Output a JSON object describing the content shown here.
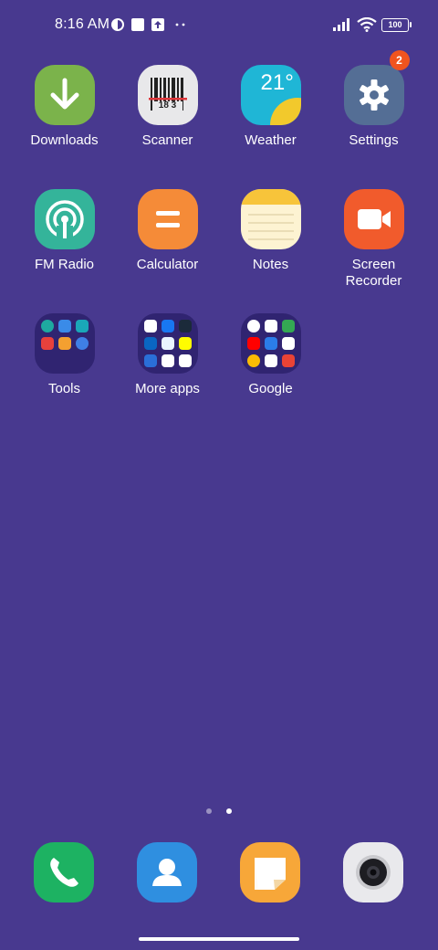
{
  "status_bar": {
    "time": "8:16 AM",
    "battery": "100"
  },
  "apps": [
    {
      "label": "Downloads",
      "icon": "downloads-icon"
    },
    {
      "label": "Scanner",
      "icon": "barcode-scanner-icon",
      "icon_text": "18 3"
    },
    {
      "label": "Weather",
      "icon": "weather-icon",
      "icon_text": "21°"
    },
    {
      "label": "Settings",
      "icon": "gear-icon",
      "badge": "2"
    },
    {
      "label": "FM Radio",
      "icon": "radio-icon"
    },
    {
      "label": "Calculator",
      "icon": "calculator-icon"
    },
    {
      "label": "Notes",
      "icon": "notes-icon"
    },
    {
      "label": "Screen Recorder",
      "label_line1": "Screen",
      "label_line2": "Recorder",
      "icon": "video-camera-icon"
    },
    {
      "label": "Tools",
      "icon": "folder-icon"
    },
    {
      "label": "More apps",
      "icon": "folder-icon"
    },
    {
      "label": "Google",
      "icon": "folder-icon"
    }
  ],
  "page_indicator": {
    "pages": 2,
    "current": 2
  },
  "dock": [
    {
      "icon": "phone-icon"
    },
    {
      "icon": "contacts-icon"
    },
    {
      "icon": "messages-icon"
    },
    {
      "icon": "camera-icon"
    }
  ],
  "colors": {
    "wallpaper": "#48398f",
    "downloads": "#7bb34b",
    "weather": "#1fb6d6",
    "settings": "#546e95",
    "fm_radio": "#34b49a",
    "calculator": "#f58b38",
    "notes": "#fdf3d2",
    "screen_recorder": "#f15b2c",
    "phone": "#1db262",
    "contacts": "#2f8fe0",
    "messages": "#f7a739",
    "camera": "#e9e9ec",
    "badge": "#f0541e"
  }
}
